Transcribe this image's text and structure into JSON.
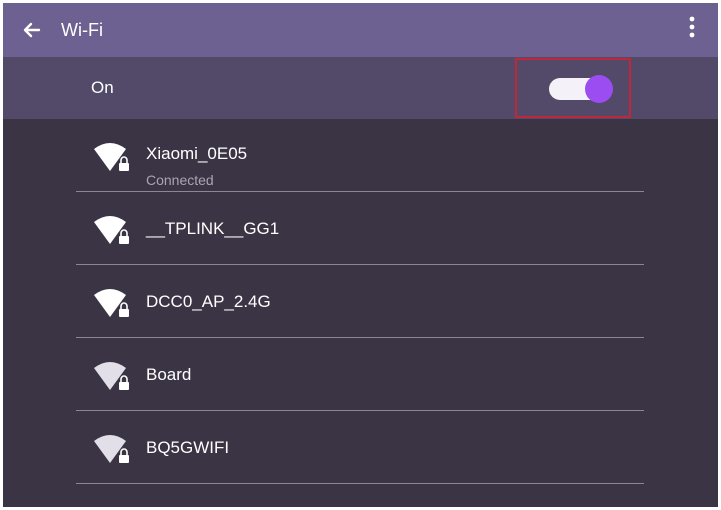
{
  "app_bar": {
    "back_icon": "arrow-left-icon",
    "title": "Wi-Fi",
    "menu_icon": "more-vert-icon"
  },
  "wifi_toggle": {
    "label": "On",
    "state": "on",
    "thumb_color": "#9b4df2"
  },
  "networks": [
    {
      "name": "Xiaomi_0E05",
      "status": "Connected",
      "signal_icon": "wifi-locked-icon"
    },
    {
      "name": "__TPLINK__GG1",
      "status": "",
      "signal_icon": "wifi-locked-icon"
    },
    {
      "name": "DCC0_AP_2.4G",
      "status": "",
      "signal_icon": "wifi-locked-icon"
    },
    {
      "name": "Board",
      "status": "",
      "signal_icon": "wifi-locked-icon"
    },
    {
      "name": "BQ5GWIFI",
      "status": "",
      "signal_icon": "wifi-locked-icon"
    }
  ],
  "colors": {
    "app_bar": "#6c6190",
    "toggle_row": "#524a68",
    "background": "#3b3444",
    "highlight": "#c0273a"
  }
}
